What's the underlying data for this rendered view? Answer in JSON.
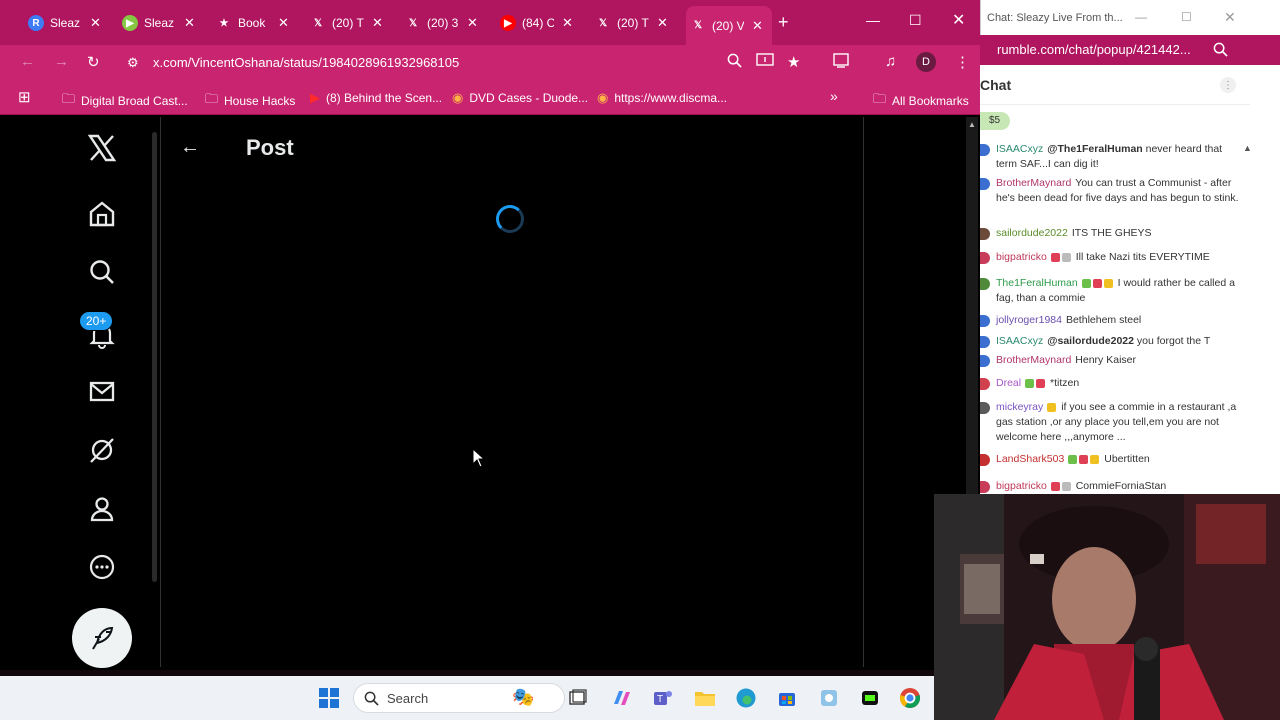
{
  "browser": {
    "tabs": [
      {
        "label": "Sleaz",
        "icon": "R",
        "icon_bg": "#3e7bf5"
      },
      {
        "label": "Sleaz",
        "icon": "▶",
        "icon_bg": "#85c742"
      },
      {
        "label": "Book",
        "icon": "★",
        "icon_bg": "transparent"
      },
      {
        "label": "(20) T",
        "icon": "𝕏",
        "icon_bg": "transparent"
      },
      {
        "label": "(20) 3",
        "icon": "𝕏",
        "icon_bg": "transparent"
      },
      {
        "label": "(84) C",
        "icon": "▶",
        "icon_bg": "#ff0000"
      },
      {
        "label": "(20) T",
        "icon": "𝕏",
        "icon_bg": "transparent"
      },
      {
        "label": "(20) V",
        "icon": "𝕏",
        "icon_bg": "transparent"
      }
    ],
    "url": "x.com/VincentOshana/status/1984028961932968105",
    "avatar_letter": "D",
    "bookmarks": [
      {
        "label": "Digital Broad Cast...",
        "icon": "folder"
      },
      {
        "label": "House Hacks",
        "icon": "folder"
      },
      {
        "label": "(8) Behind the Scen...",
        "icon": "youtube"
      },
      {
        "label": "DVD Cases - Duode...",
        "icon": "site"
      },
      {
        "label": "https://www.discma...",
        "icon": "site"
      }
    ],
    "all_bookmarks": "All Bookmarks"
  },
  "xpage": {
    "title": "Post",
    "notification_badge": "20+"
  },
  "chat": {
    "window_title": "Chat: Sleazy Live From th...",
    "url": "rumble.com/chat/popup/421442...",
    "header": "Chat",
    "rant_amount": "$5",
    "messages": [
      {
        "user": "ISAACxyz",
        "text": "@The1FeralHuman never heard that term SAF...I can dig it!",
        "color": "#2b8a6e",
        "av": "#3a6fd1",
        "mention": "@The1FeralHuman"
      },
      {
        "user": "BrotherMaynard",
        "text": "You can trust a Communist - after he's been dead for five days and has begun to stink.",
        "color": "#b0356a",
        "av": "#3a6fd1"
      },
      {
        "user": "sailordude2022",
        "text": "ITS THE GHEYS",
        "color": "#5b8c2a",
        "av": "#6b4a3a"
      },
      {
        "user": "bigpatricko",
        "text": "Ill take Nazi tits EVERYTIME",
        "color": "#c0395a",
        "av": "#c83c5a",
        "badges": [
          "#e04055",
          "#bbbbbb"
        ]
      },
      {
        "user": "The1FeralHuman",
        "text": "I would rather be called a fag, than a commie",
        "color": "#2d9a4a",
        "av": "#4f8a3a",
        "badges": [
          "#6cc04a",
          "#e04055",
          "#f0c020"
        ]
      },
      {
        "user": "jollyroger1984",
        "text": "Bethlehem steel",
        "color": "#6a4fb0",
        "av": "#3a6fd1"
      },
      {
        "user": "ISAACxyz",
        "text": "@sailordude2022 you forgot the T",
        "color": "#2b8a6e",
        "av": "#3a6fd1",
        "mention": "@sailordude2022"
      },
      {
        "user": "BrotherMaynard",
        "text": "Henry Kaiser",
        "color": "#b0356a",
        "av": "#3a6fd1"
      },
      {
        "user": "Dreal",
        "text": "*titzen",
        "color": "#a855c8",
        "av": "#d0404f",
        "badges": [
          "#6cc04a",
          "#e04055"
        ]
      },
      {
        "user": "mickeyray",
        "text": "if you see a commie in a restaurant ,a gas station ,or any place you tell,em you are not welcome here ,,,anymore ...",
        "color": "#7a55c0",
        "av": "#5a5a5a",
        "badges": [
          "#f0c020"
        ]
      },
      {
        "user": "LandShark503",
        "text": "Ubertitten",
        "color": "#c43030",
        "av": "#c43030",
        "badges": [
          "#6cc04a",
          "#e04055",
          "#f0c020"
        ]
      },
      {
        "user": "bigpatricko",
        "text": "CommieForniaStan",
        "color": "#c0395a",
        "av": "#c83c5a",
        "badges": [
          "#e04055",
          "#bbbbbb"
        ]
      }
    ]
  },
  "taskbar": {
    "search_placeholder": "Search"
  }
}
